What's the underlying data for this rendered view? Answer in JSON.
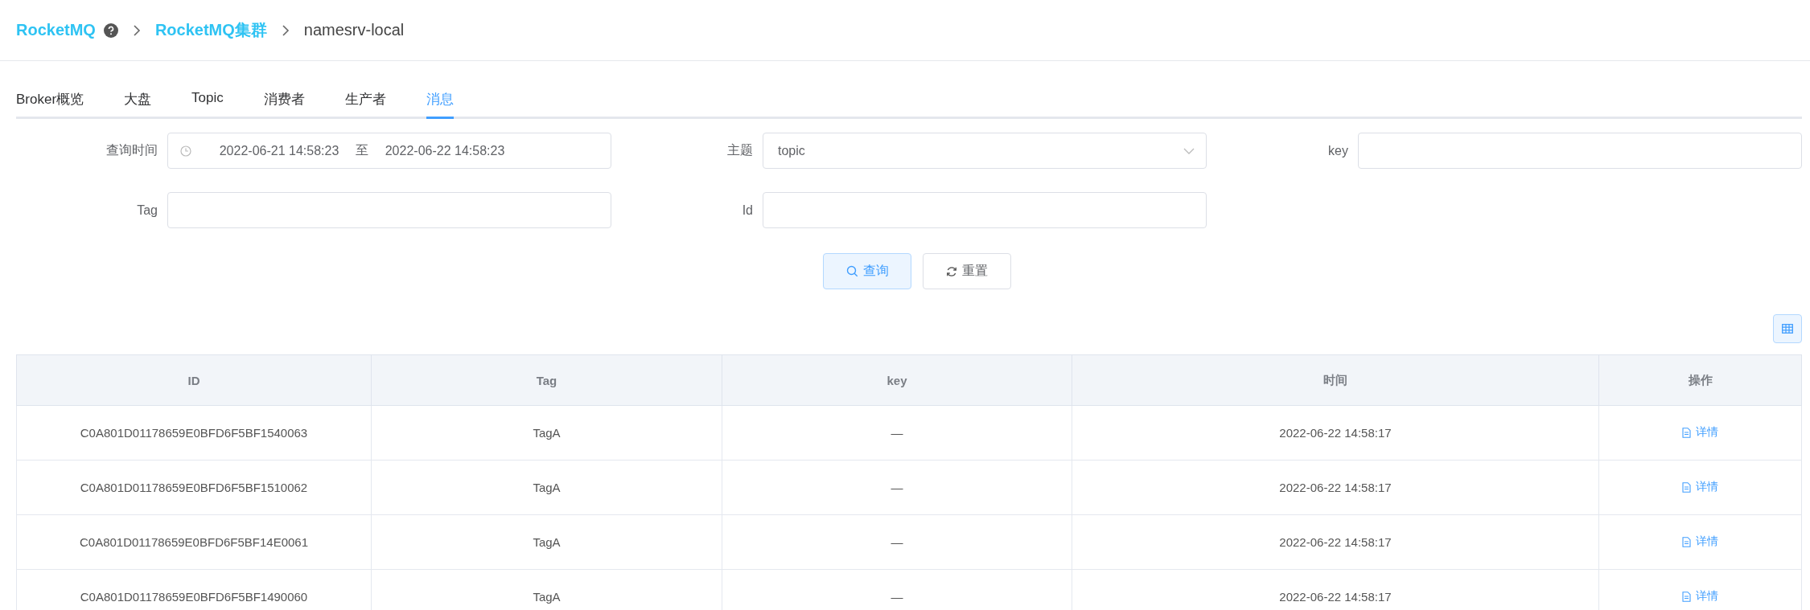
{
  "breadcrumb": [
    {
      "label": "RocketMQ",
      "link": true,
      "help": true
    },
    {
      "label": "RocketMQ集群",
      "link": true,
      "help": false
    },
    {
      "label": "namesrv-local",
      "link": false,
      "help": false
    }
  ],
  "tabs": [
    {
      "label": "Broker概览",
      "selected": false
    },
    {
      "label": "大盘",
      "selected": false
    },
    {
      "label": "Topic",
      "selected": false
    },
    {
      "label": "消费者",
      "selected": false
    },
    {
      "label": "生产者",
      "selected": false
    },
    {
      "label": "消息",
      "selected": true
    }
  ],
  "form": {
    "fields": [
      {
        "kind": "daterange",
        "label": "查询时间",
        "start": "2022-06-21 14:58:23",
        "separator": "至",
        "end": "2022-06-22 14:58:23"
      },
      {
        "kind": "select",
        "label": "主题",
        "value": "topic"
      },
      {
        "kind": "input",
        "label": "key"
      },
      {
        "kind": "input",
        "label": "Tag"
      },
      {
        "kind": "input",
        "label": "Id"
      }
    ],
    "buttons": [
      {
        "label": "查询",
        "kind": "primary"
      },
      {
        "label": "重置",
        "kind": "default"
      }
    ]
  },
  "table": {
    "columns": [
      "ID",
      "Tag",
      "key",
      "时间",
      "操作"
    ],
    "rows": [
      {
        "id": "C0A801D01178659E0BFD6F5BF1540063",
        "tag": "TagA",
        "key": "—",
        "time": "2022-06-22 14:58:17",
        "action": "详情"
      },
      {
        "id": "C0A801D01178659E0BFD6F5BF1510062",
        "tag": "TagA",
        "key": "—",
        "time": "2022-06-22 14:58:17",
        "action": "详情"
      },
      {
        "id": "C0A801D01178659E0BFD6F5BF14E0061",
        "tag": "TagA",
        "key": "—",
        "time": "2022-06-22 14:58:17",
        "action": "详情"
      },
      {
        "id": "C0A801D01178659E0BFD6F5BF1490060",
        "tag": "TagA",
        "key": "—",
        "time": "2022-06-22 14:58:17",
        "action": "详情"
      }
    ]
  }
}
